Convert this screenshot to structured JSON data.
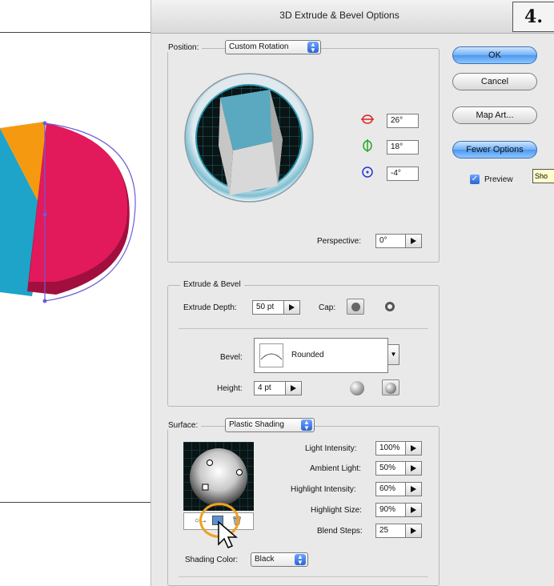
{
  "dialog": {
    "title": "3D Extrude & Bevel Options",
    "step_label": "4."
  },
  "buttons": {
    "ok": "OK",
    "cancel": "Cancel",
    "map_art": "Map Art...",
    "fewer_options": "Fewer Options",
    "preview": "Preview",
    "preview_checked": true,
    "tooltip_fragment": "Sho"
  },
  "position": {
    "label": "Position:",
    "value": "Custom Rotation",
    "rotation_x": "26°",
    "rotation_y": "18°",
    "rotation_z": "-4°",
    "perspective_label": "Perspective:",
    "perspective_value": "0°"
  },
  "extrude": {
    "group_label": "Extrude & Bevel",
    "depth_label": "Extrude Depth:",
    "depth_value": "50 pt",
    "cap_label": "Cap:",
    "bevel_label": "Bevel:",
    "bevel_value": "Rounded",
    "height_label": "Height:",
    "height_value": "4 pt"
  },
  "surface": {
    "label": "Surface:",
    "value": "Plastic Shading",
    "light_intensity_label": "Light Intensity:",
    "light_intensity": "100%",
    "ambient_light_label": "Ambient Light:",
    "ambient_light": "50%",
    "highlight_intensity_label": "Highlight Intensity:",
    "highlight_intensity": "60%",
    "highlight_size_label": "Highlight Size:",
    "highlight_size": "90%",
    "blend_steps_label": "Blend Steps:",
    "blend_steps": "25",
    "shading_color_label": "Shading Color:",
    "shading_color": "Black"
  },
  "colors": {
    "pie_magenta": "#e2195a",
    "pie_orange": "#f59a10",
    "pie_cyan": "#1ea3c9",
    "cube_face": "#5aa9c0",
    "highlight_ring": "#f0a020"
  }
}
